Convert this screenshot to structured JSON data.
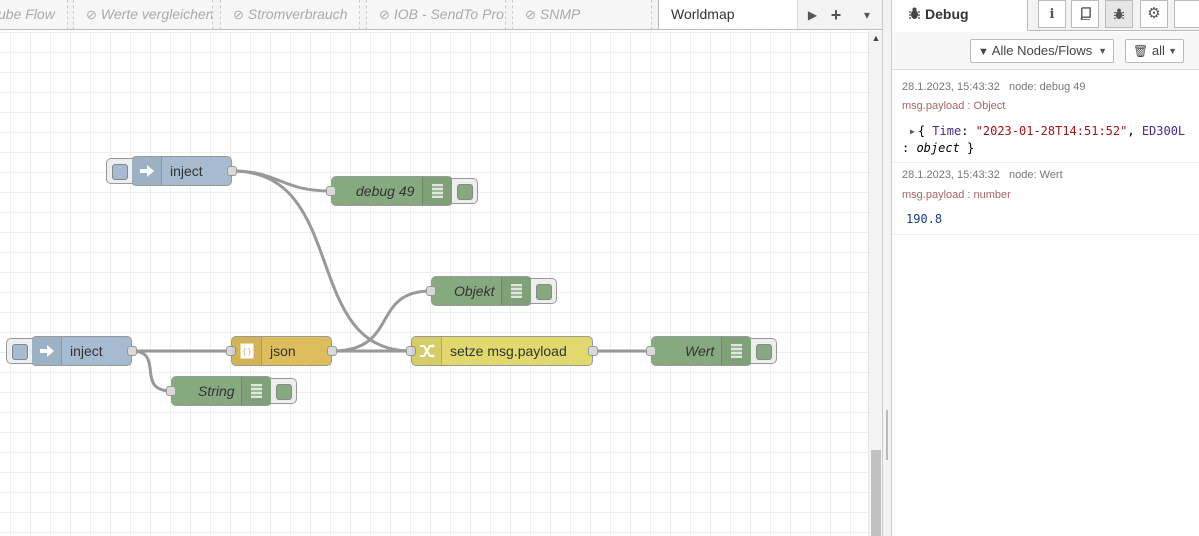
{
  "tabs": [
    {
      "label": "ube Flow",
      "disabled": false,
      "active": false
    },
    {
      "label": "Werte vergleichen",
      "disabled": true,
      "active": false
    },
    {
      "label": "Stromverbrauch",
      "disabled": true,
      "active": false
    },
    {
      "label": "IOB - SendTo Pro",
      "disabled": true,
      "active": false
    },
    {
      "label": "SNMP",
      "disabled": true,
      "active": false
    },
    {
      "label": "Worldmap",
      "disabled": false,
      "active": true
    }
  ],
  "tab_buttons": {
    "scroll_right": "▶",
    "add": "+",
    "menu": "▾"
  },
  "nodes": {
    "inject1": {
      "label": "inject",
      "type": "inject"
    },
    "debug49": {
      "label": "debug 49",
      "type": "debug"
    },
    "objekt": {
      "label": "Objekt",
      "type": "debug"
    },
    "inject2": {
      "label": "inject",
      "type": "inject"
    },
    "json": {
      "label": "json",
      "type": "json"
    },
    "setze": {
      "label": "setze msg.payload",
      "type": "change"
    },
    "wert": {
      "label": "Wert",
      "type": "debug"
    },
    "string": {
      "label": "String",
      "type": "debug"
    }
  },
  "colors": {
    "inject": "#a6bbcf",
    "debug": "#87a980",
    "json": "#debd5c",
    "change": "#e2d96e",
    "wire": "#999999"
  },
  "sidebar": {
    "title": "Debug",
    "icons": [
      "info-icon",
      "book-icon",
      "bug-icon",
      "gear-icon"
    ],
    "filter_label": "Alle Nodes/Flows",
    "clear_label": "all",
    "messages": [
      {
        "timestamp": "28.1.2023, 15:43:32",
        "node": "node: debug 49",
        "topic": "msg.payload : Object",
        "preview_open": "{ ",
        "key1": "Time",
        "colon": ": ",
        "value1": "\"2023-01-28T14:51:52\"",
        "sep": ", ",
        "key2": "ED300L",
        "line2_prefix": ": ",
        "line2_type": "object",
        "line2_close": " }"
      },
      {
        "timestamp": "28.1.2023, 15:43:32",
        "node": "node: Wert",
        "topic": "msg.payload : number",
        "value": "190.8"
      }
    ]
  }
}
